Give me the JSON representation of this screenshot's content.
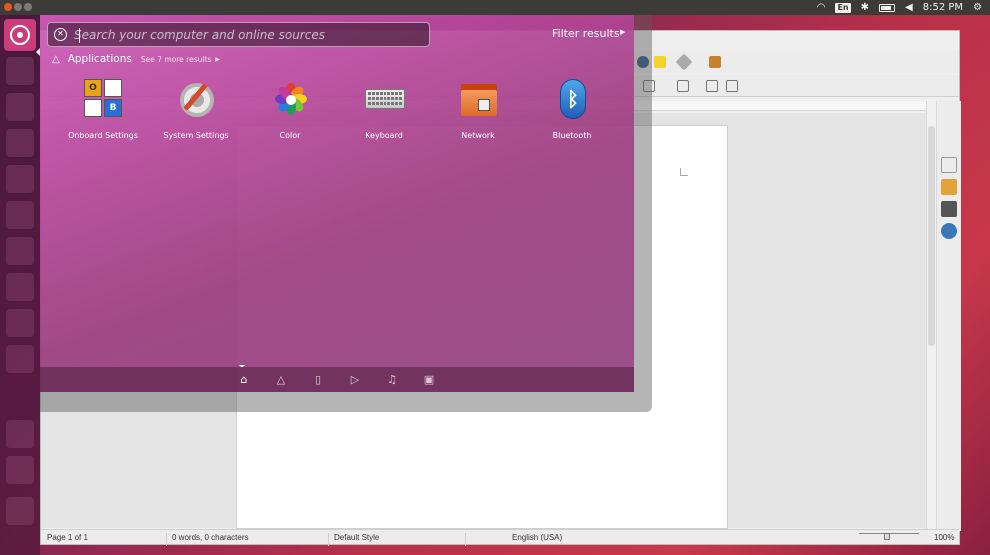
{
  "top_panel": {
    "keyboard_layout": "En",
    "clock": "8:52 PM",
    "icons": [
      "wifi-icon",
      "keyboard-layout-indicator",
      "bluetooth-icon",
      "battery-icon",
      "volume-icon",
      "session-gear-icon"
    ]
  },
  "dash": {
    "search": {
      "placeholder": "Search your computer and online sources",
      "value": ""
    },
    "filter_label": "Filter results",
    "category": {
      "title": "Applications",
      "more": "See 7 more results"
    },
    "apps": [
      {
        "label": "Onboard Settings",
        "icon": "onboard-icon"
      },
      {
        "label": "System Settings",
        "icon": "system-settings-icon"
      },
      {
        "label": "Color",
        "icon": "color-icon"
      },
      {
        "label": "Keyboard",
        "icon": "keyboard-icon"
      },
      {
        "label": "Network",
        "icon": "network-folder-icon"
      },
      {
        "label": "Bluetooth",
        "icon": "bluetooth-icon"
      }
    ],
    "lenses": [
      "home-lens-icon",
      "applications-lens-icon",
      "files-lens-icon",
      "video-lens-icon",
      "music-lens-icon",
      "photos-lens-icon"
    ],
    "active_lens": "home-lens-icon",
    "onboard_keys": [
      "O",
      "",
      "",
      "B"
    ]
  },
  "writer": {
    "status": {
      "page": "Page 1 of 1",
      "words": "0 words, 0 characters",
      "style": "Default Style",
      "language": "English (USA)",
      "zoom": "100%"
    }
  },
  "colors": {
    "panel": "#3c3b37",
    "accent": "#cb3c7a",
    "dash_tint": "#c04a9a"
  }
}
